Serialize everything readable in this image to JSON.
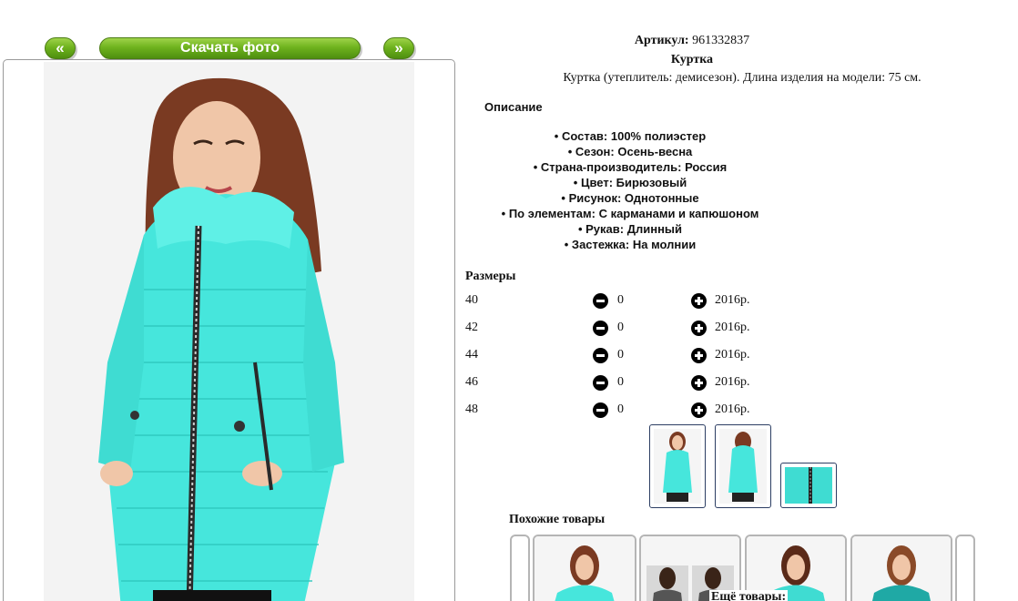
{
  "viewer": {
    "prev_label": "«",
    "next_label": "»",
    "download_label": "Скачать фото"
  },
  "product": {
    "sku_label": "Артикул:",
    "sku_value": "961332837",
    "title": "Куртка",
    "description": "Куртка (утеплитель: демисезон). Длина изделия на модели: 75 см.",
    "details_heading": "Описание",
    "specs": [
      "Состав: 100% полиэстер",
      "Сезон: Осень-весна",
      "Страна-производитель: Россия",
      "Цвет: Бирюзовый",
      "Рисунок: Однотонные",
      "По элементам: С карманами и капюшоном",
      "Рукав: Длинный",
      "Застежка: На молнии"
    ],
    "accent_color": "#3fe3d8"
  },
  "sizes": {
    "heading": "Размеры",
    "rows": [
      {
        "size": "40",
        "qty": "0",
        "price": "2016р."
      },
      {
        "size": "42",
        "qty": "0",
        "price": "2016р."
      },
      {
        "size": "44",
        "qty": "0",
        "price": "2016р."
      },
      {
        "size": "46",
        "qty": "0",
        "price": "2016р."
      },
      {
        "size": "48",
        "qty": "0",
        "price": "2016р."
      }
    ],
    "icons": {
      "decrease": "minus-circle-icon",
      "increase": "plus-circle-icon"
    }
  },
  "similar": {
    "heading": "Похожие товары",
    "more_label": "Ещё товары:"
  }
}
